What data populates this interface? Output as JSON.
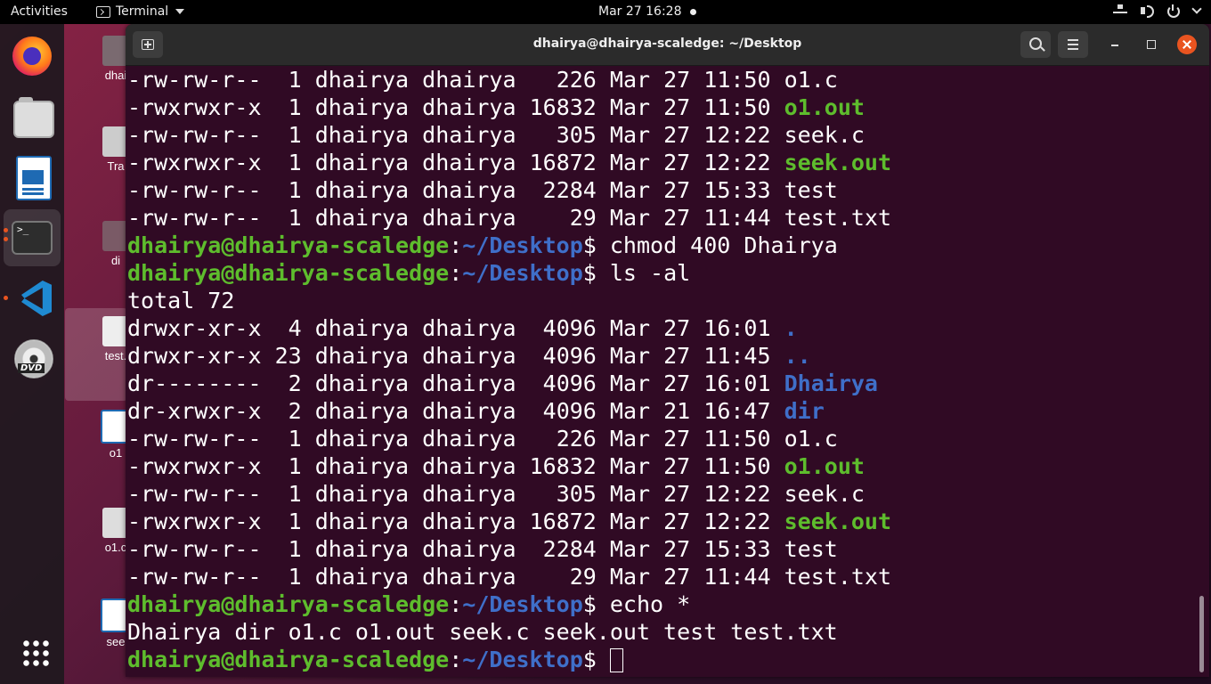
{
  "topbar": {
    "activities": "Activities",
    "app_name": "Terminal",
    "clock": "Mar 27  16:28"
  },
  "desktop": {
    "icons": [
      "dhai",
      "Tra",
      "di",
      "test.",
      "o1",
      "o1.c",
      "see"
    ]
  },
  "window": {
    "title": "dhairya@dhairya-scaledge: ~/Desktop"
  },
  "terminal": {
    "prompt_user": "dhairya@dhairya-scaledge",
    "prompt_path": "~/Desktop",
    "lines": [
      {
        "type": "ls",
        "perms": "-rw-rw-r--",
        "links": " 1",
        "owner": "dhairya",
        "group": "dhairya",
        "size": "  226",
        "date": "Mar 27 11:50",
        "name": "o1.c",
        "kind": "file"
      },
      {
        "type": "ls",
        "perms": "-rwxrwxr-x",
        "links": " 1",
        "owner": "dhairya",
        "group": "dhairya",
        "size": "16832",
        "date": "Mar 27 11:50",
        "name": "o1.out",
        "kind": "exec"
      },
      {
        "type": "ls",
        "perms": "-rw-rw-r--",
        "links": " 1",
        "owner": "dhairya",
        "group": "dhairya",
        "size": "  305",
        "date": "Mar 27 12:22",
        "name": "seek.c",
        "kind": "file"
      },
      {
        "type": "ls",
        "perms": "-rwxrwxr-x",
        "links": " 1",
        "owner": "dhairya",
        "group": "dhairya",
        "size": "16872",
        "date": "Mar 27 12:22",
        "name": "seek.out",
        "kind": "exec"
      },
      {
        "type": "ls",
        "perms": "-rw-rw-r--",
        "links": " 1",
        "owner": "dhairya",
        "group": "dhairya",
        "size": " 2284",
        "date": "Mar 27 15:33",
        "name": "test",
        "kind": "file"
      },
      {
        "type": "ls",
        "perms": "-rw-rw-r--",
        "links": " 1",
        "owner": "dhairya",
        "group": "dhairya",
        "size": "   29",
        "date": "Mar 27 11:44",
        "name": "test.txt",
        "kind": "file"
      },
      {
        "type": "prompt",
        "cmd": "chmod 400 Dhairya"
      },
      {
        "type": "prompt",
        "cmd": "ls -al"
      },
      {
        "type": "text",
        "text": "total 72"
      },
      {
        "type": "ls",
        "perms": "drwxr-xr-x",
        "links": " 4",
        "owner": "dhairya",
        "group": "dhairya",
        "size": " 4096",
        "date": "Mar 27 16:01",
        "name": ".",
        "kind": "dir"
      },
      {
        "type": "ls",
        "perms": "drwxr-xr-x",
        "links": "23",
        "owner": "dhairya",
        "group": "dhairya",
        "size": " 4096",
        "date": "Mar 27 11:45",
        "name": "..",
        "kind": "dir"
      },
      {
        "type": "ls",
        "perms": "dr--------",
        "links": " 2",
        "owner": "dhairya",
        "group": "dhairya",
        "size": " 4096",
        "date": "Mar 27 16:01",
        "name": "Dhairya",
        "kind": "dir"
      },
      {
        "type": "ls",
        "perms": "dr-xrwxr-x",
        "links": " 2",
        "owner": "dhairya",
        "group": "dhairya",
        "size": " 4096",
        "date": "Mar 21 16:47",
        "name": "dir",
        "kind": "dir"
      },
      {
        "type": "ls",
        "perms": "-rw-rw-r--",
        "links": " 1",
        "owner": "dhairya",
        "group": "dhairya",
        "size": "  226",
        "date": "Mar 27 11:50",
        "name": "o1.c",
        "kind": "file"
      },
      {
        "type": "ls",
        "perms": "-rwxrwxr-x",
        "links": " 1",
        "owner": "dhairya",
        "group": "dhairya",
        "size": "16832",
        "date": "Mar 27 11:50",
        "name": "o1.out",
        "kind": "exec"
      },
      {
        "type": "ls",
        "perms": "-rw-rw-r--",
        "links": " 1",
        "owner": "dhairya",
        "group": "dhairya",
        "size": "  305",
        "date": "Mar 27 12:22",
        "name": "seek.c",
        "kind": "file"
      },
      {
        "type": "ls",
        "perms": "-rwxrwxr-x",
        "links": " 1",
        "owner": "dhairya",
        "group": "dhairya",
        "size": "16872",
        "date": "Mar 27 12:22",
        "name": "seek.out",
        "kind": "exec"
      },
      {
        "type": "ls",
        "perms": "-rw-rw-r--",
        "links": " 1",
        "owner": "dhairya",
        "group": "dhairya",
        "size": " 2284",
        "date": "Mar 27 15:33",
        "name": "test",
        "kind": "file"
      },
      {
        "type": "ls",
        "perms": "-rw-rw-r--",
        "links": " 1",
        "owner": "dhairya",
        "group": "dhairya",
        "size": "   29",
        "date": "Mar 27 11:44",
        "name": "test.txt",
        "kind": "file"
      },
      {
        "type": "prompt",
        "cmd": "echo *"
      },
      {
        "type": "text",
        "text": "Dhairya dir o1.c o1.out seek.c seek.out test test.txt"
      },
      {
        "type": "prompt",
        "cmd": "",
        "cursor": true
      }
    ]
  },
  "colors": {
    "terminal_bg": "#300a24",
    "prompt_user": "#5ebd2d",
    "prompt_path": "#3f6fc9",
    "accent_close": "#e95420"
  }
}
